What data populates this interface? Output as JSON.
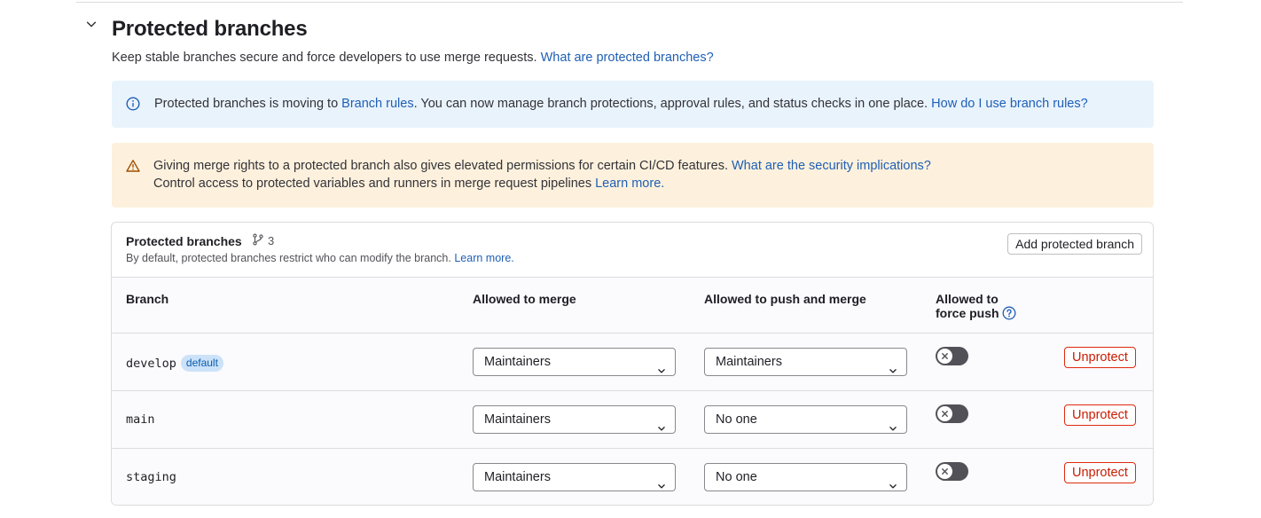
{
  "section": {
    "title": "Protected branches",
    "description": "Keep stable branches secure and force developers to use merge requests.",
    "description_link": "What are protected branches?"
  },
  "info_alert": {
    "text_before": "Protected branches is moving to",
    "link1": "Branch rules",
    "text_middle": ". You can now manage branch protections, approval rules, and status checks in one place.",
    "link2": "How do I use branch rules?"
  },
  "warning_alert": {
    "line1": "Giving merge rights to a protected branch also gives elevated permissions for certain CI/CD features.",
    "line1_link": "What are the security implications?",
    "line2": "Control access to protected variables and runners in merge request pipelines",
    "line2_link": "Learn more."
  },
  "card": {
    "title": "Protected branches",
    "count": "3",
    "subtitle": "By default, protected branches restrict who can modify the branch.",
    "subtitle_link": "Learn more.",
    "add_button": "Add protected branch"
  },
  "table": {
    "headers": {
      "branch": "Branch",
      "merge": "Allowed to merge",
      "push": "Allowed to push and merge",
      "force_line1": "Allowed to",
      "force_line2": "force push"
    },
    "rows": [
      {
        "branch": "develop",
        "badge": "default",
        "merge": "Maintainers",
        "push": "Maintainers",
        "force_push": false,
        "action": "Unprotect"
      },
      {
        "branch": "main",
        "badge": "",
        "merge": "Maintainers",
        "push": "No one",
        "force_push": false,
        "action": "Unprotect"
      },
      {
        "branch": "staging",
        "badge": "",
        "merge": "Maintainers",
        "push": "No one",
        "force_push": false,
        "action": "Unprotect"
      }
    ]
  },
  "colors": {
    "link": "#1f5fb5",
    "info_bg": "#e9f3fc",
    "warning_bg": "#fdf1dd",
    "danger": "#dd2b0e",
    "toggle_off": "#535158"
  },
  "icons": {
    "collapse": "chevron-down-icon",
    "info": "info-circle-icon",
    "warning": "warning-triangle-icon",
    "branch": "branch-icon",
    "help": "question-circle-icon",
    "select": "chevron-down-icon",
    "toggle": "close-icon"
  }
}
